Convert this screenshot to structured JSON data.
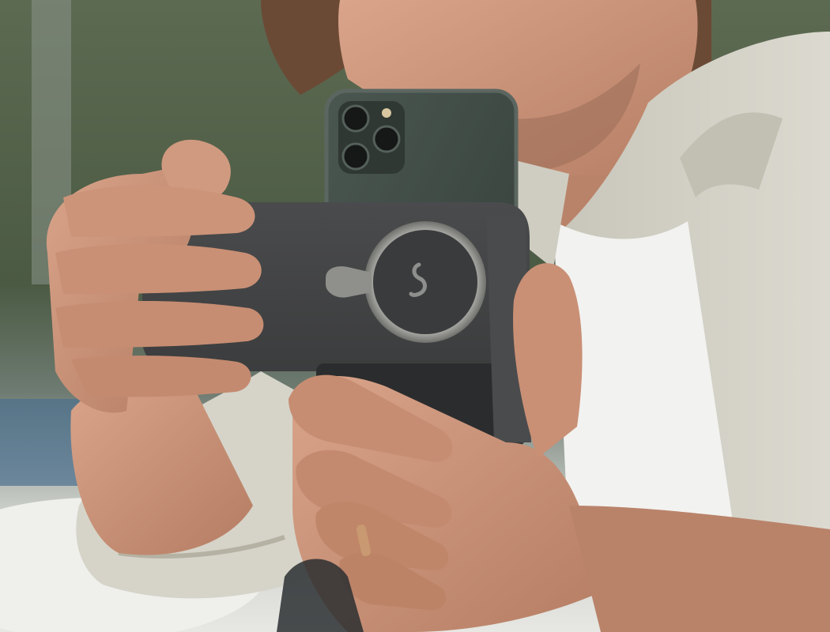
{
  "photo": {
    "subject": "person-holding-smartphone-camera-grip",
    "colors": {
      "background_foliage": "#4f5c45",
      "background_sky": "#b9bdb6",
      "background_water": "#4b6f8e",
      "shirt_light": "#d9d7cc",
      "shirt_shadow": "#b9b6a8",
      "tshirt_white": "#f2f2f0",
      "skin": "#c9937a",
      "skin_shadow": "#a8735c",
      "hair": "#6b4a35",
      "phone_green": "#3f4a44",
      "phone_frame": "#5c6660",
      "grip_dark": "#3c3d3e",
      "grip_shadow": "#2b2c2d",
      "mount_ring": "#8f8f8c",
      "ring_gold": "#c99a72"
    },
    "icons": [
      "camera-lens-icon",
      "grip-logo-icon"
    ]
  }
}
